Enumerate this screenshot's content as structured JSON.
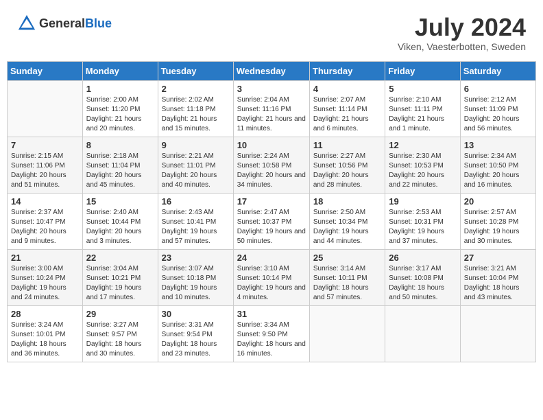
{
  "header": {
    "logo_general": "General",
    "logo_blue": "Blue",
    "month_year": "July 2024",
    "location": "Viken, Vaesterbotten, Sweden"
  },
  "weekdays": [
    "Sunday",
    "Monday",
    "Tuesday",
    "Wednesday",
    "Thursday",
    "Friday",
    "Saturday"
  ],
  "weeks": [
    [
      {
        "day": "",
        "sunrise": "",
        "sunset": "",
        "daylight": ""
      },
      {
        "day": "1",
        "sunrise": "Sunrise: 2:00 AM",
        "sunset": "Sunset: 11:20 PM",
        "daylight": "Daylight: 21 hours and 20 minutes."
      },
      {
        "day": "2",
        "sunrise": "Sunrise: 2:02 AM",
        "sunset": "Sunset: 11:18 PM",
        "daylight": "Daylight: 21 hours and 15 minutes."
      },
      {
        "day": "3",
        "sunrise": "Sunrise: 2:04 AM",
        "sunset": "Sunset: 11:16 PM",
        "daylight": "Daylight: 21 hours and 11 minutes."
      },
      {
        "day": "4",
        "sunrise": "Sunrise: 2:07 AM",
        "sunset": "Sunset: 11:14 PM",
        "daylight": "Daylight: 21 hours and 6 minutes."
      },
      {
        "day": "5",
        "sunrise": "Sunrise: 2:10 AM",
        "sunset": "Sunset: 11:11 PM",
        "daylight": "Daylight: 21 hours and 1 minute."
      },
      {
        "day": "6",
        "sunrise": "Sunrise: 2:12 AM",
        "sunset": "Sunset: 11:09 PM",
        "daylight": "Daylight: 20 hours and 56 minutes."
      }
    ],
    [
      {
        "day": "7",
        "sunrise": "Sunrise: 2:15 AM",
        "sunset": "Sunset: 11:06 PM",
        "daylight": "Daylight: 20 hours and 51 minutes."
      },
      {
        "day": "8",
        "sunrise": "Sunrise: 2:18 AM",
        "sunset": "Sunset: 11:04 PM",
        "daylight": "Daylight: 20 hours and 45 minutes."
      },
      {
        "day": "9",
        "sunrise": "Sunrise: 2:21 AM",
        "sunset": "Sunset: 11:01 PM",
        "daylight": "Daylight: 20 hours and 40 minutes."
      },
      {
        "day": "10",
        "sunrise": "Sunrise: 2:24 AM",
        "sunset": "Sunset: 10:58 PM",
        "daylight": "Daylight: 20 hours and 34 minutes."
      },
      {
        "day": "11",
        "sunrise": "Sunrise: 2:27 AM",
        "sunset": "Sunset: 10:56 PM",
        "daylight": "Daylight: 20 hours and 28 minutes."
      },
      {
        "day": "12",
        "sunrise": "Sunrise: 2:30 AM",
        "sunset": "Sunset: 10:53 PM",
        "daylight": "Daylight: 20 hours and 22 minutes."
      },
      {
        "day": "13",
        "sunrise": "Sunrise: 2:34 AM",
        "sunset": "Sunset: 10:50 PM",
        "daylight": "Daylight: 20 hours and 16 minutes."
      }
    ],
    [
      {
        "day": "14",
        "sunrise": "Sunrise: 2:37 AM",
        "sunset": "Sunset: 10:47 PM",
        "daylight": "Daylight: 20 hours and 9 minutes."
      },
      {
        "day": "15",
        "sunrise": "Sunrise: 2:40 AM",
        "sunset": "Sunset: 10:44 PM",
        "daylight": "Daylight: 20 hours and 3 minutes."
      },
      {
        "day": "16",
        "sunrise": "Sunrise: 2:43 AM",
        "sunset": "Sunset: 10:41 PM",
        "daylight": "Daylight: 19 hours and 57 minutes."
      },
      {
        "day": "17",
        "sunrise": "Sunrise: 2:47 AM",
        "sunset": "Sunset: 10:37 PM",
        "daylight": "Daylight: 19 hours and 50 minutes."
      },
      {
        "day": "18",
        "sunrise": "Sunrise: 2:50 AM",
        "sunset": "Sunset: 10:34 PM",
        "daylight": "Daylight: 19 hours and 44 minutes."
      },
      {
        "day": "19",
        "sunrise": "Sunrise: 2:53 AM",
        "sunset": "Sunset: 10:31 PM",
        "daylight": "Daylight: 19 hours and 37 minutes."
      },
      {
        "day": "20",
        "sunrise": "Sunrise: 2:57 AM",
        "sunset": "Sunset: 10:28 PM",
        "daylight": "Daylight: 19 hours and 30 minutes."
      }
    ],
    [
      {
        "day": "21",
        "sunrise": "Sunrise: 3:00 AM",
        "sunset": "Sunset: 10:24 PM",
        "daylight": "Daylight: 19 hours and 24 minutes."
      },
      {
        "day": "22",
        "sunrise": "Sunrise: 3:04 AM",
        "sunset": "Sunset: 10:21 PM",
        "daylight": "Daylight: 19 hours and 17 minutes."
      },
      {
        "day": "23",
        "sunrise": "Sunrise: 3:07 AM",
        "sunset": "Sunset: 10:18 PM",
        "daylight": "Daylight: 19 hours and 10 minutes."
      },
      {
        "day": "24",
        "sunrise": "Sunrise: 3:10 AM",
        "sunset": "Sunset: 10:14 PM",
        "daylight": "Daylight: 19 hours and 4 minutes."
      },
      {
        "day": "25",
        "sunrise": "Sunrise: 3:14 AM",
        "sunset": "Sunset: 10:11 PM",
        "daylight": "Daylight: 18 hours and 57 minutes."
      },
      {
        "day": "26",
        "sunrise": "Sunrise: 3:17 AM",
        "sunset": "Sunset: 10:08 PM",
        "daylight": "Daylight: 18 hours and 50 minutes."
      },
      {
        "day": "27",
        "sunrise": "Sunrise: 3:21 AM",
        "sunset": "Sunset: 10:04 PM",
        "daylight": "Daylight: 18 hours and 43 minutes."
      }
    ],
    [
      {
        "day": "28",
        "sunrise": "Sunrise: 3:24 AM",
        "sunset": "Sunset: 10:01 PM",
        "daylight": "Daylight: 18 hours and 36 minutes."
      },
      {
        "day": "29",
        "sunrise": "Sunrise: 3:27 AM",
        "sunset": "Sunset: 9:57 PM",
        "daylight": "Daylight: 18 hours and 30 minutes."
      },
      {
        "day": "30",
        "sunrise": "Sunrise: 3:31 AM",
        "sunset": "Sunset: 9:54 PM",
        "daylight": "Daylight: 18 hours and 23 minutes."
      },
      {
        "day": "31",
        "sunrise": "Sunrise: 3:34 AM",
        "sunset": "Sunset: 9:50 PM",
        "daylight": "Daylight: 18 hours and 16 minutes."
      },
      {
        "day": "",
        "sunrise": "",
        "sunset": "",
        "daylight": ""
      },
      {
        "day": "",
        "sunrise": "",
        "sunset": "",
        "daylight": ""
      },
      {
        "day": "",
        "sunrise": "",
        "sunset": "",
        "daylight": ""
      }
    ]
  ]
}
